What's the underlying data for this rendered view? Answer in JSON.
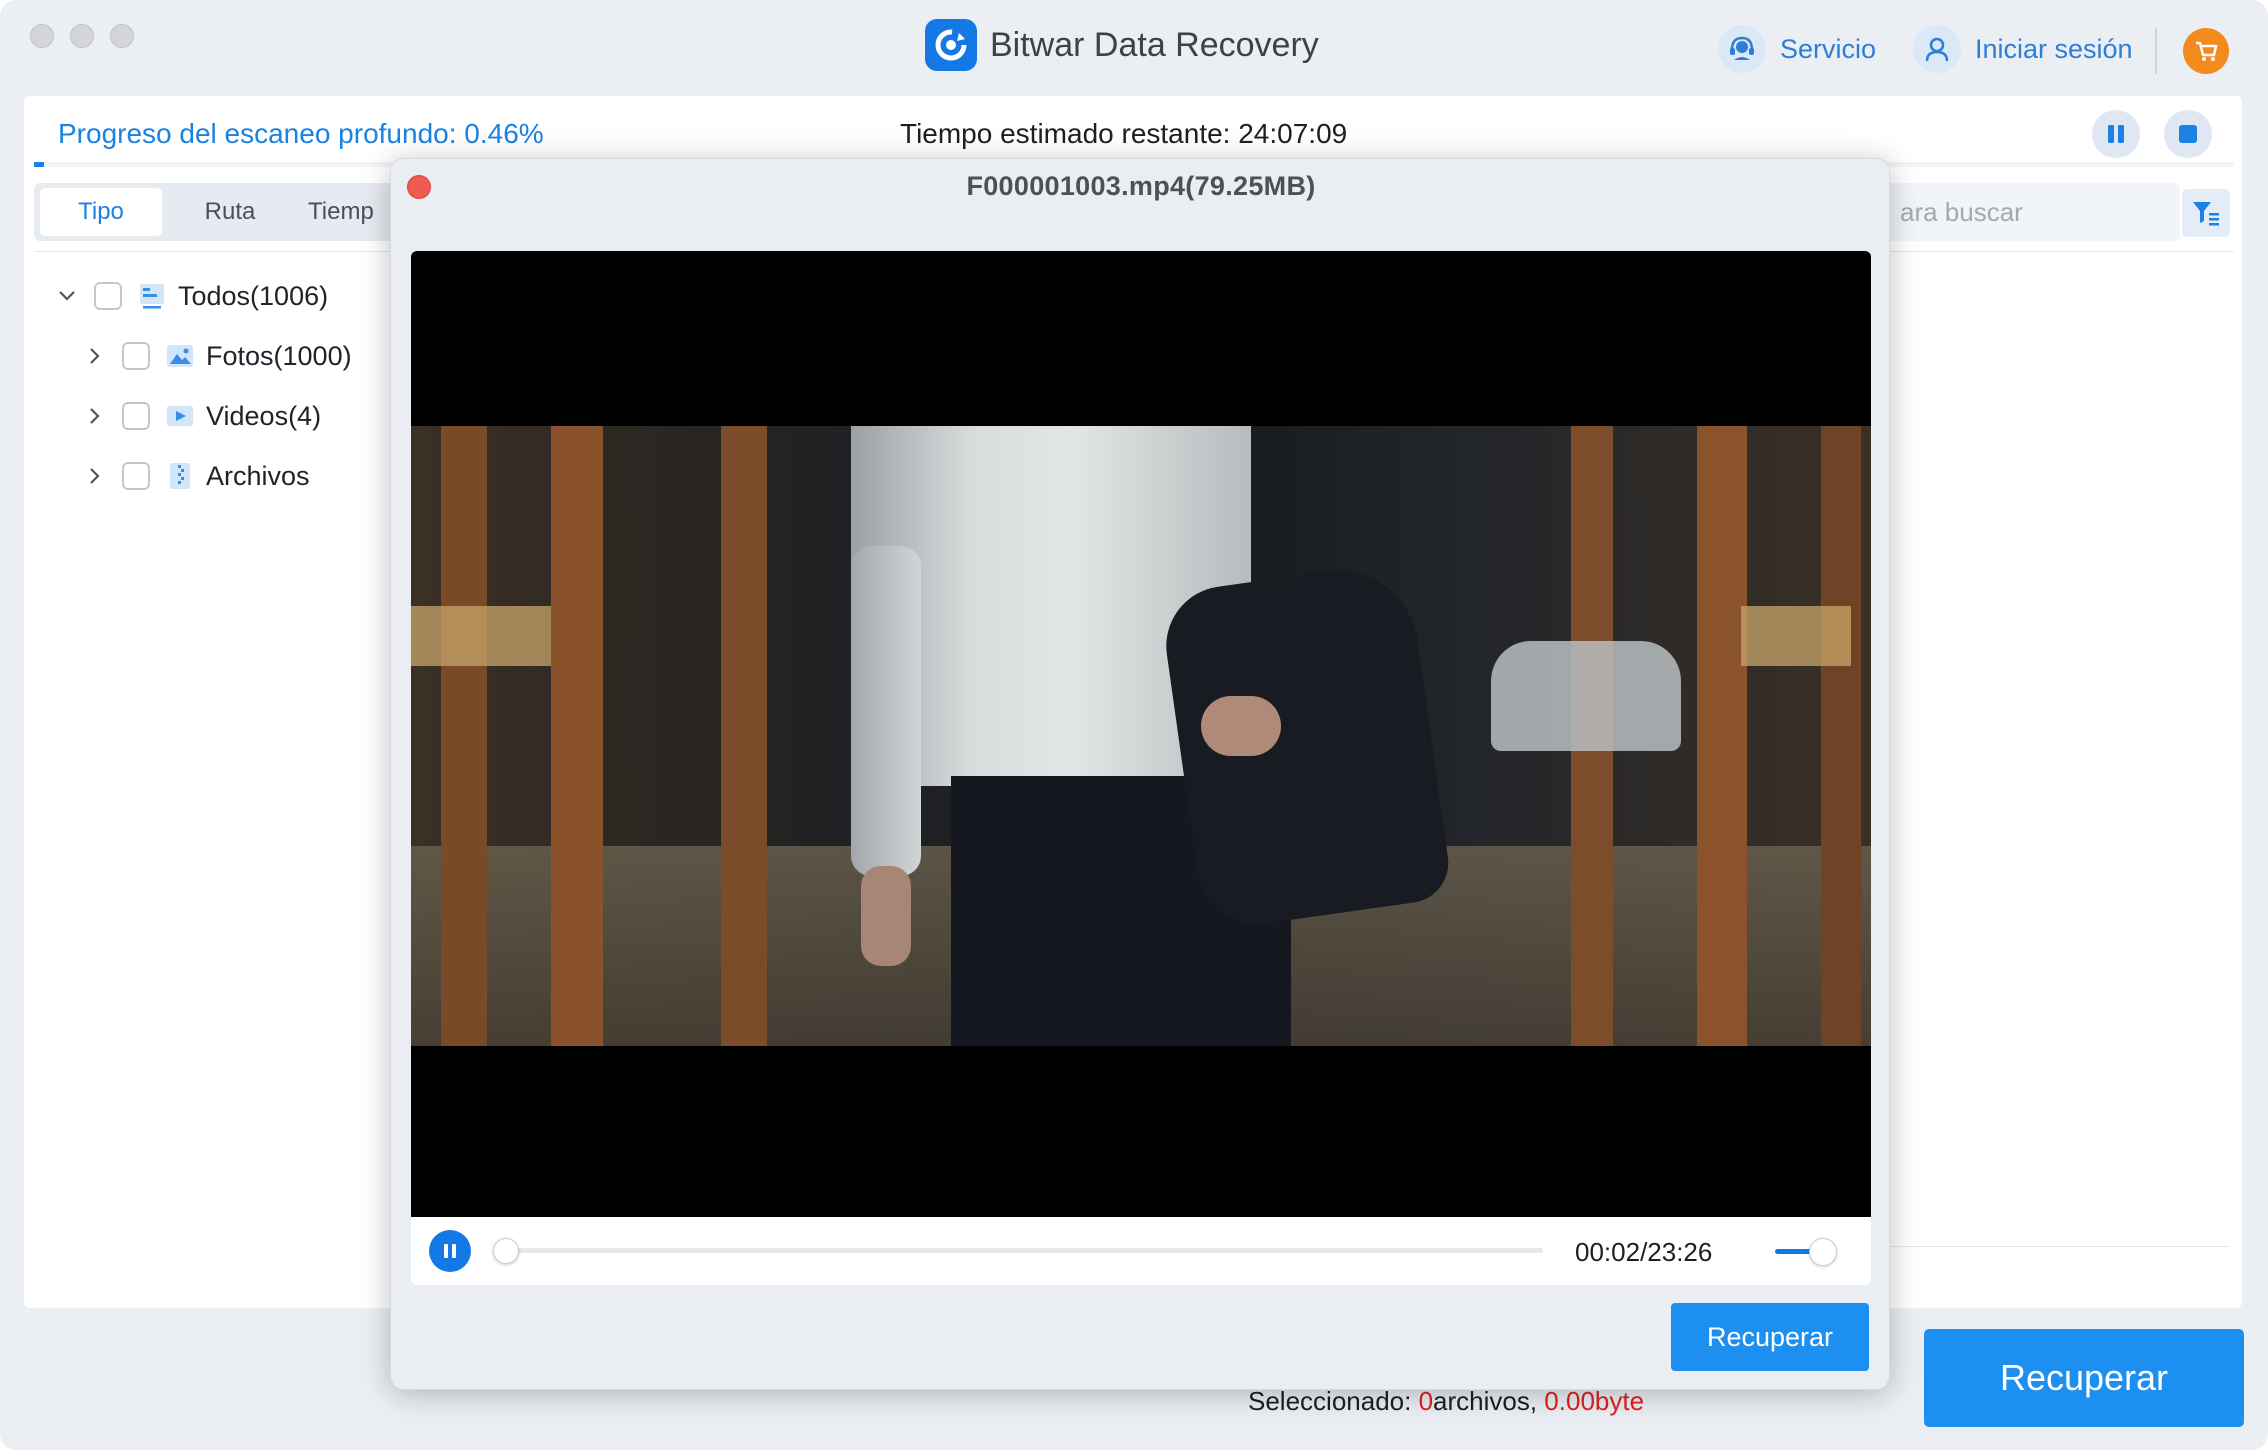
{
  "window": {
    "title": "Bitwar Data Recovery",
    "logo_icon": "bitwar-logo-icon"
  },
  "header": {
    "service_label": "Servicio",
    "login_label": "Iniciar sesión",
    "cart_icon": "cart-icon"
  },
  "scan": {
    "progress_label": "Progreso del escaneo profundo: 0.46%",
    "progress_fraction": 0.0046,
    "eta_label": "Tiempo estimado restante: 24:07:09"
  },
  "tabs": [
    {
      "label": "Tipo",
      "active": true
    },
    {
      "label": "Ruta",
      "active": false
    },
    {
      "label": "Tiemp",
      "active": false
    }
  ],
  "search": {
    "placeholder_visible": "ara buscar"
  },
  "tree": [
    {
      "label": "Todos(1006)",
      "expanded": true,
      "icon": "all-files-icon"
    },
    {
      "label": "Fotos(1000)",
      "expanded": false,
      "icon": "image-icon"
    },
    {
      "label": "Videos(4)",
      "expanded": false,
      "icon": "video-icon"
    },
    {
      "label": "Archivos",
      "expanded": false,
      "icon": "archive-icon"
    }
  ],
  "footer": {
    "selected_prefix": "Seleccionado: ",
    "selected_count": "0",
    "selected_files_word": "archivos, ",
    "selected_size": "0.00byte",
    "recover_label": "Recuperar"
  },
  "preview": {
    "title": "F000001003.mp4(79.25MB)",
    "time": "00:02/23:26",
    "seek_fraction": 0.0,
    "volume_fraction": 1.0,
    "recover_label": "Recuperar"
  },
  "colors": {
    "accent": "#1a82e2",
    "button": "#1c8ff0",
    "danger": "#e02020",
    "cart": "#f28a1e",
    "close": "#ee5a52"
  }
}
